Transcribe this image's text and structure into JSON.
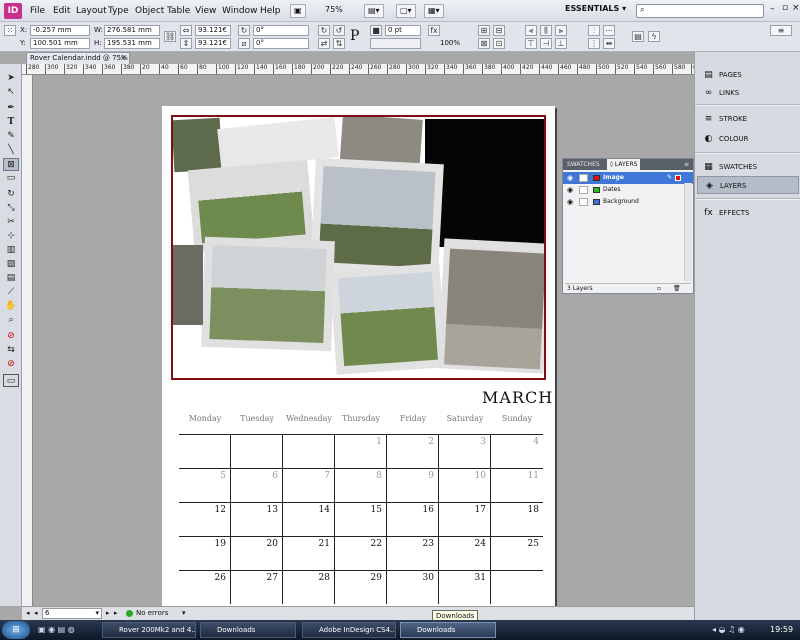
{
  "app": {
    "logo": "ID"
  },
  "menubar": {
    "items": [
      "File",
      "Edit",
      "Layout",
      "Type",
      "Object",
      "Table",
      "View",
      "Window",
      "Help"
    ],
    "zoom": "75%",
    "workspace": "ESSENTIALS",
    "workspace_icon": "chevron-down-icon",
    "search_placeholder": ""
  },
  "control_panel": {
    "x_label": "X:",
    "x_value": "-0.257 mm",
    "y_label": "Y:",
    "y_value": "100.501 mm",
    "w_label": "W:",
    "w_value": "276.581 mm",
    "h_label": "H:",
    "h_value": "195.531 mm",
    "scale_x": "93.121€",
    "scale_y": "93.121€",
    "rotate": "0°",
    "shear": "0°",
    "stroke_weight": "0 pt",
    "opacity": "100%"
  },
  "document": {
    "tab_title": "Rover Calendar.indd @ 75%",
    "close_glyph": "×"
  },
  "ruler": {
    "ticks": [
      "280",
      "300",
      "320",
      "340",
      "360",
      "380",
      "20",
      "40",
      "60",
      "80",
      "100",
      "120",
      "140",
      "160",
      "180",
      "200",
      "220",
      "240",
      "260",
      "280",
      "300",
      "320",
      "340",
      "360",
      "380",
      "400",
      "420",
      "440",
      "460",
      "480",
      "500",
      "520",
      "540",
      "560",
      "580",
      "600"
    ]
  },
  "calendar": {
    "month": "MARCH",
    "day_names": [
      "Monday",
      "Tuesday",
      "Wednesday",
      "Thursday",
      "Friday",
      "Saturday",
      "Sunday"
    ],
    "weeks": [
      [
        "",
        "",
        "",
        "1",
        "2",
        "3",
        "4"
      ],
      [
        "5",
        "6",
        "7",
        "8",
        "9",
        "10",
        "11"
      ],
      [
        "12",
        "13",
        "14",
        "15",
        "16",
        "17",
        "18"
      ],
      [
        "19",
        "20",
        "21",
        "22",
        "23",
        "24",
        "25"
      ],
      [
        "26",
        "27",
        "28",
        "29",
        "30",
        "31",
        ""
      ]
    ]
  },
  "layers_panel": {
    "tabs": [
      "SWATCHES",
      "◊ LAYERS"
    ],
    "layers": [
      {
        "name": "Image",
        "color": "#e01010",
        "selected": true
      },
      {
        "name": "Dates",
        "color": "#22c022",
        "selected": false
      },
      {
        "name": "Background",
        "color": "#3b6fe0",
        "selected": false
      }
    ],
    "footer": "3 Layers"
  },
  "right_panel": {
    "items": [
      {
        "label": "PAGES",
        "icon": "pages-icon"
      },
      {
        "label": "LINKS",
        "icon": "links-icon"
      },
      {
        "label": "STROKE",
        "icon": "stroke-icon"
      },
      {
        "label": "COLOUR",
        "icon": "colour-icon"
      },
      {
        "label": "SWATCHES",
        "icon": "swatches-icon"
      },
      {
        "label": "LAYERS",
        "icon": "layers-icon"
      },
      {
        "label": "EFFECTS",
        "icon": "effects-icon"
      }
    ]
  },
  "status_bar": {
    "page": "6",
    "errors": "No errors"
  },
  "tooltip": "Downloads",
  "taskbar": {
    "tasks": [
      "Rover 200Mk2 and 4...",
      "Downloads",
      "Adobe InDesign CS4...",
      "Downloads"
    ],
    "active_index": 3,
    "clock": "19:59"
  }
}
